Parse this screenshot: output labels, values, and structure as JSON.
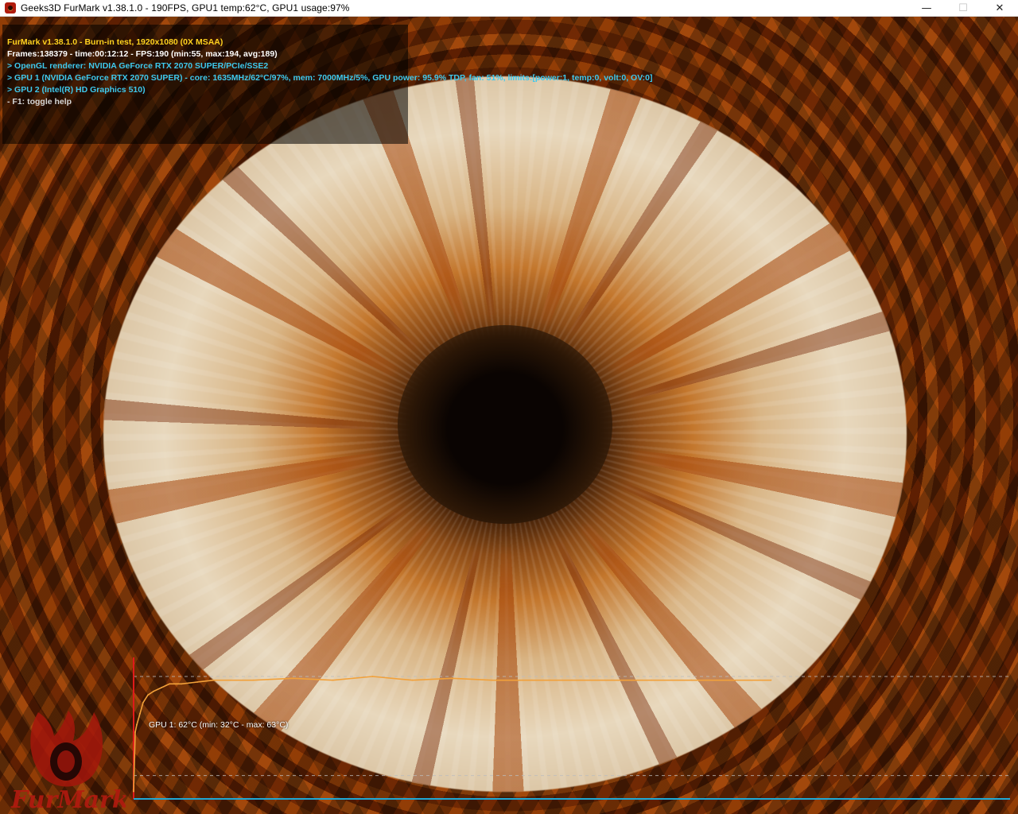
{
  "window": {
    "title": "Geeks3D FurMark v1.38.1.0 - 190FPS, GPU1 temp:62°C, GPU1 usage:97%",
    "controls": {
      "minimize": "—",
      "maximize": "☐",
      "close": "✕"
    }
  },
  "hud": {
    "line1": "FurMark v1.38.1.0 - Burn-in test, 1920x1080 (0X MSAA)",
    "line2": "Frames:138379 - time:00:12:12 - FPS:190 (min:55, max:194, avg:189)",
    "line3": "> OpenGL renderer: NVIDIA GeForce RTX 2070 SUPER/PCIe/SSE2",
    "line4": "> GPU 1 (NVIDIA GeForce RTX 2070 SUPER) - core: 1635MHz/62°C/97%, mem: 7000MHz/5%, GPU power: 95.9% TDP, fan: 51%, limits:[power:1, temp:0, volt:0, OV:0]",
    "line5": "> GPU 2 (Intel(R) HD Graphics 510)",
    "line6": "- F1: toggle help"
  },
  "graph": {
    "label": "GPU 1: 62°C (min: 32°C - max: 63°C)",
    "colors": {
      "line": "#f2a13a",
      "axis_left": "#e01a1a",
      "axis_bottom": "#1fa9d6",
      "guide": "#bdbdbd"
    }
  },
  "chart_data": {
    "type": "line",
    "title": "GPU 1: 62°C (min: 32°C - max: 63°C)",
    "xlabel": "",
    "ylabel": "",
    "ylim": [
      30,
      66
    ],
    "grid": false,
    "series": [
      {
        "x": [
          0,
          2,
          4,
          8,
          12,
          18,
          25,
          35,
          45,
          60,
          80,
          100,
          150,
          200,
          250,
          300,
          350,
          400,
          450,
          500,
          550,
          600,
          650,
          700,
          750,
          800
        ],
        "values": [
          32,
          48,
          50,
          53,
          56,
          58,
          59,
          60,
          61,
          61,
          61.5,
          62,
          62,
          62.5,
          62,
          63,
          62,
          62.5,
          62,
          62,
          62,
          62,
          62,
          62,
          62,
          62
        ]
      }
    ]
  },
  "logo": {
    "text": "FurMark"
  }
}
